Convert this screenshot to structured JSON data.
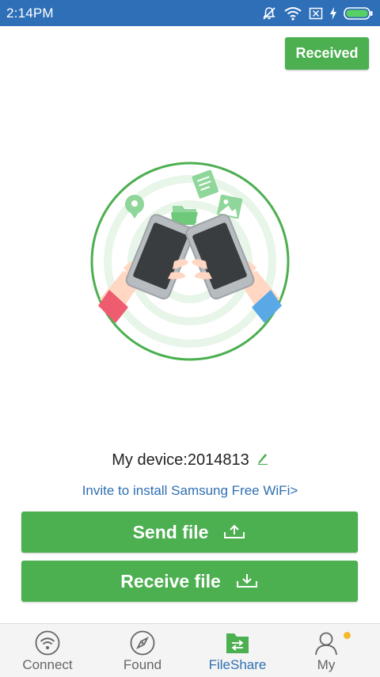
{
  "status_bar": {
    "time": "2:14PM",
    "icons": [
      "notifications-off-icon",
      "wifi-icon",
      "sim-x-icon",
      "charging-icon",
      "battery-icon"
    ],
    "color": "#2e6fb8"
  },
  "header": {
    "received_label": "Received"
  },
  "device": {
    "label": "My device:2014813"
  },
  "invite": {
    "text": "Invite to install Samsung Free WiFi>"
  },
  "actions": {
    "send_label": "Send file",
    "receive_label": "Receive file"
  },
  "nav": {
    "items": [
      {
        "label": "Connect",
        "icon": "wifi-circle-icon"
      },
      {
        "label": "Found",
        "icon": "compass-icon"
      },
      {
        "label": "FileShare",
        "icon": "fileshare-icon",
        "active": true
      },
      {
        "label": "My",
        "icon": "person-icon"
      }
    ]
  },
  "colors": {
    "accent_green": "#4caf50",
    "link_blue": "#2f6fb0",
    "notification_dot": "#f5b82e"
  }
}
